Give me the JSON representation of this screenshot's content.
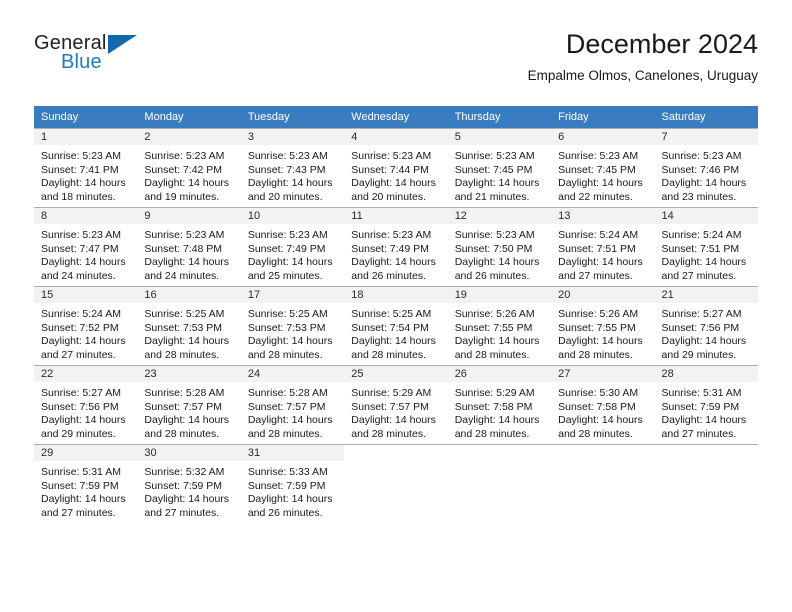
{
  "brand": {
    "word_one": "General",
    "word_two": "Blue",
    "logo_icon": "triangle-logo-icon",
    "colors": {
      "general": "#231f20",
      "blue": "#1f7bc1",
      "triangle": "#1668ad"
    }
  },
  "header": {
    "title": "December 2024",
    "subtitle": "Empalme Olmos, Canelones, Uruguay"
  },
  "calendar": {
    "header_bg": "#3a7cc0",
    "weekdays": [
      "Sunday",
      "Monday",
      "Tuesday",
      "Wednesday",
      "Thursday",
      "Friday",
      "Saturday"
    ],
    "weeks": [
      [
        {
          "day": "1",
          "sunrise": "Sunrise: 5:23 AM",
          "sunset": "Sunset: 7:41 PM",
          "daylight_line1": "Daylight: 14 hours",
          "daylight_line2": "and 18 minutes."
        },
        {
          "day": "2",
          "sunrise": "Sunrise: 5:23 AM",
          "sunset": "Sunset: 7:42 PM",
          "daylight_line1": "Daylight: 14 hours",
          "daylight_line2": "and 19 minutes."
        },
        {
          "day": "3",
          "sunrise": "Sunrise: 5:23 AM",
          "sunset": "Sunset: 7:43 PM",
          "daylight_line1": "Daylight: 14 hours",
          "daylight_line2": "and 20 minutes."
        },
        {
          "day": "4",
          "sunrise": "Sunrise: 5:23 AM",
          "sunset": "Sunset: 7:44 PM",
          "daylight_line1": "Daylight: 14 hours",
          "daylight_line2": "and 20 minutes."
        },
        {
          "day": "5",
          "sunrise": "Sunrise: 5:23 AM",
          "sunset": "Sunset: 7:45 PM",
          "daylight_line1": "Daylight: 14 hours",
          "daylight_line2": "and 21 minutes."
        },
        {
          "day": "6",
          "sunrise": "Sunrise: 5:23 AM",
          "sunset": "Sunset: 7:45 PM",
          "daylight_line1": "Daylight: 14 hours",
          "daylight_line2": "and 22 minutes."
        },
        {
          "day": "7",
          "sunrise": "Sunrise: 5:23 AM",
          "sunset": "Sunset: 7:46 PM",
          "daylight_line1": "Daylight: 14 hours",
          "daylight_line2": "and 23 minutes."
        }
      ],
      [
        {
          "day": "8",
          "sunrise": "Sunrise: 5:23 AM",
          "sunset": "Sunset: 7:47 PM",
          "daylight_line1": "Daylight: 14 hours",
          "daylight_line2": "and 24 minutes."
        },
        {
          "day": "9",
          "sunrise": "Sunrise: 5:23 AM",
          "sunset": "Sunset: 7:48 PM",
          "daylight_line1": "Daylight: 14 hours",
          "daylight_line2": "and 24 minutes."
        },
        {
          "day": "10",
          "sunrise": "Sunrise: 5:23 AM",
          "sunset": "Sunset: 7:49 PM",
          "daylight_line1": "Daylight: 14 hours",
          "daylight_line2": "and 25 minutes."
        },
        {
          "day": "11",
          "sunrise": "Sunrise: 5:23 AM",
          "sunset": "Sunset: 7:49 PM",
          "daylight_line1": "Daylight: 14 hours",
          "daylight_line2": "and 26 minutes."
        },
        {
          "day": "12",
          "sunrise": "Sunrise: 5:23 AM",
          "sunset": "Sunset: 7:50 PM",
          "daylight_line1": "Daylight: 14 hours",
          "daylight_line2": "and 26 minutes."
        },
        {
          "day": "13",
          "sunrise": "Sunrise: 5:24 AM",
          "sunset": "Sunset: 7:51 PM",
          "daylight_line1": "Daylight: 14 hours",
          "daylight_line2": "and 27 minutes."
        },
        {
          "day": "14",
          "sunrise": "Sunrise: 5:24 AM",
          "sunset": "Sunset: 7:51 PM",
          "daylight_line1": "Daylight: 14 hours",
          "daylight_line2": "and 27 minutes."
        }
      ],
      [
        {
          "day": "15",
          "sunrise": "Sunrise: 5:24 AM",
          "sunset": "Sunset: 7:52 PM",
          "daylight_line1": "Daylight: 14 hours",
          "daylight_line2": "and 27 minutes."
        },
        {
          "day": "16",
          "sunrise": "Sunrise: 5:25 AM",
          "sunset": "Sunset: 7:53 PM",
          "daylight_line1": "Daylight: 14 hours",
          "daylight_line2": "and 28 minutes."
        },
        {
          "day": "17",
          "sunrise": "Sunrise: 5:25 AM",
          "sunset": "Sunset: 7:53 PM",
          "daylight_line1": "Daylight: 14 hours",
          "daylight_line2": "and 28 minutes."
        },
        {
          "day": "18",
          "sunrise": "Sunrise: 5:25 AM",
          "sunset": "Sunset: 7:54 PM",
          "daylight_line1": "Daylight: 14 hours",
          "daylight_line2": "and 28 minutes."
        },
        {
          "day": "19",
          "sunrise": "Sunrise: 5:26 AM",
          "sunset": "Sunset: 7:55 PM",
          "daylight_line1": "Daylight: 14 hours",
          "daylight_line2": "and 28 minutes."
        },
        {
          "day": "20",
          "sunrise": "Sunrise: 5:26 AM",
          "sunset": "Sunset: 7:55 PM",
          "daylight_line1": "Daylight: 14 hours",
          "daylight_line2": "and 28 minutes."
        },
        {
          "day": "21",
          "sunrise": "Sunrise: 5:27 AM",
          "sunset": "Sunset: 7:56 PM",
          "daylight_line1": "Daylight: 14 hours",
          "daylight_line2": "and 29 minutes."
        }
      ],
      [
        {
          "day": "22",
          "sunrise": "Sunrise: 5:27 AM",
          "sunset": "Sunset: 7:56 PM",
          "daylight_line1": "Daylight: 14 hours",
          "daylight_line2": "and 29 minutes."
        },
        {
          "day": "23",
          "sunrise": "Sunrise: 5:28 AM",
          "sunset": "Sunset: 7:57 PM",
          "daylight_line1": "Daylight: 14 hours",
          "daylight_line2": "and 28 minutes."
        },
        {
          "day": "24",
          "sunrise": "Sunrise: 5:28 AM",
          "sunset": "Sunset: 7:57 PM",
          "daylight_line1": "Daylight: 14 hours",
          "daylight_line2": "and 28 minutes."
        },
        {
          "day": "25",
          "sunrise": "Sunrise: 5:29 AM",
          "sunset": "Sunset: 7:57 PM",
          "daylight_line1": "Daylight: 14 hours",
          "daylight_line2": "and 28 minutes."
        },
        {
          "day": "26",
          "sunrise": "Sunrise: 5:29 AM",
          "sunset": "Sunset: 7:58 PM",
          "daylight_line1": "Daylight: 14 hours",
          "daylight_line2": "and 28 minutes."
        },
        {
          "day": "27",
          "sunrise": "Sunrise: 5:30 AM",
          "sunset": "Sunset: 7:58 PM",
          "daylight_line1": "Daylight: 14 hours",
          "daylight_line2": "and 28 minutes."
        },
        {
          "day": "28",
          "sunrise": "Sunrise: 5:31 AM",
          "sunset": "Sunset: 7:59 PM",
          "daylight_line1": "Daylight: 14 hours",
          "daylight_line2": "and 27 minutes."
        }
      ],
      [
        {
          "day": "29",
          "sunrise": "Sunrise: 5:31 AM",
          "sunset": "Sunset: 7:59 PM",
          "daylight_line1": "Daylight: 14 hours",
          "daylight_line2": "and 27 minutes."
        },
        {
          "day": "30",
          "sunrise": "Sunrise: 5:32 AM",
          "sunset": "Sunset: 7:59 PM",
          "daylight_line1": "Daylight: 14 hours",
          "daylight_line2": "and 27 minutes."
        },
        {
          "day": "31",
          "sunrise": "Sunrise: 5:33 AM",
          "sunset": "Sunset: 7:59 PM",
          "daylight_line1": "Daylight: 14 hours",
          "daylight_line2": "and 26 minutes."
        },
        {
          "day": "",
          "sunrise": "",
          "sunset": "",
          "daylight_line1": "",
          "daylight_line2": ""
        },
        {
          "day": "",
          "sunrise": "",
          "sunset": "",
          "daylight_line1": "",
          "daylight_line2": ""
        },
        {
          "day": "",
          "sunrise": "",
          "sunset": "",
          "daylight_line1": "",
          "daylight_line2": ""
        },
        {
          "day": "",
          "sunrise": "",
          "sunset": "",
          "daylight_line1": "",
          "daylight_line2": ""
        }
      ]
    ]
  }
}
